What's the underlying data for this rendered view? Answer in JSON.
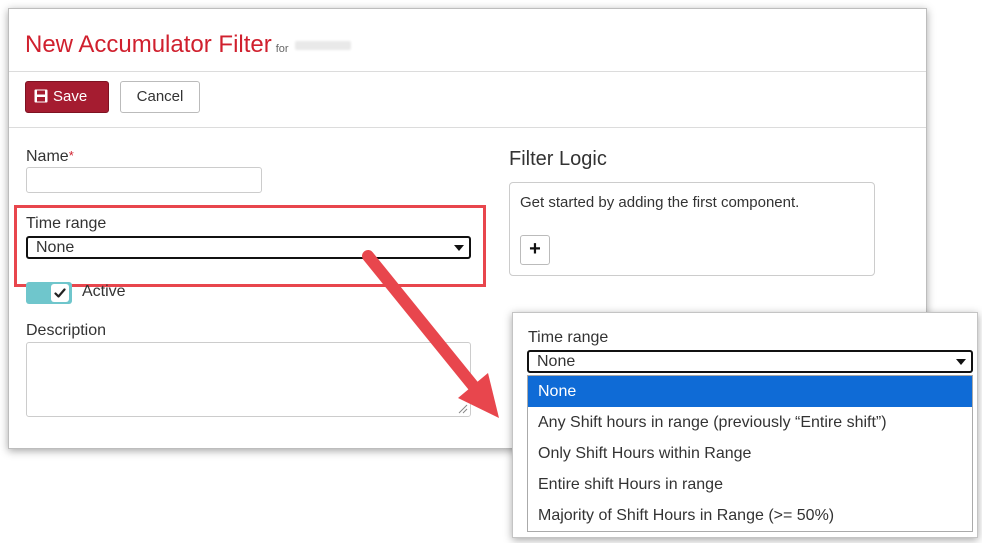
{
  "header": {
    "title": "New Accumulator Filter",
    "title_suffix": "for"
  },
  "toolbar": {
    "save_label": "Save",
    "cancel_label": "Cancel"
  },
  "form": {
    "name_label": "Name",
    "name_required_mark": "*",
    "name_value": "",
    "time_range_label": "Time range",
    "time_range_value": "None",
    "active_label": "Active",
    "active_checked": true,
    "description_label": "Description",
    "description_value": ""
  },
  "filter_logic": {
    "heading": "Filter Logic",
    "empty_text": "Get started by adding the first component.",
    "add_label": "+"
  },
  "zoom": {
    "label": "Time range",
    "selected_value": "None",
    "options": [
      "None",
      "Any Shift hours in range (previously “Entire shift”)",
      "Only Shift Hours within Range",
      "Entire shift Hours in range",
      "Majority of Shift Hours in Range (>= 50%)"
    ],
    "highlighted_index": 0
  },
  "colors": {
    "title_red": "#d0202e",
    "save_button": "#a51c30",
    "highlight_border": "#e8464d",
    "toggle_teal": "#6fc6cc",
    "option_selected": "#0f6bd6"
  },
  "icons": {
    "save": "floppy-disk-icon",
    "check": "checkmark-icon",
    "caret": "chevron-down-icon",
    "arrow": "red-arrow-callout"
  }
}
